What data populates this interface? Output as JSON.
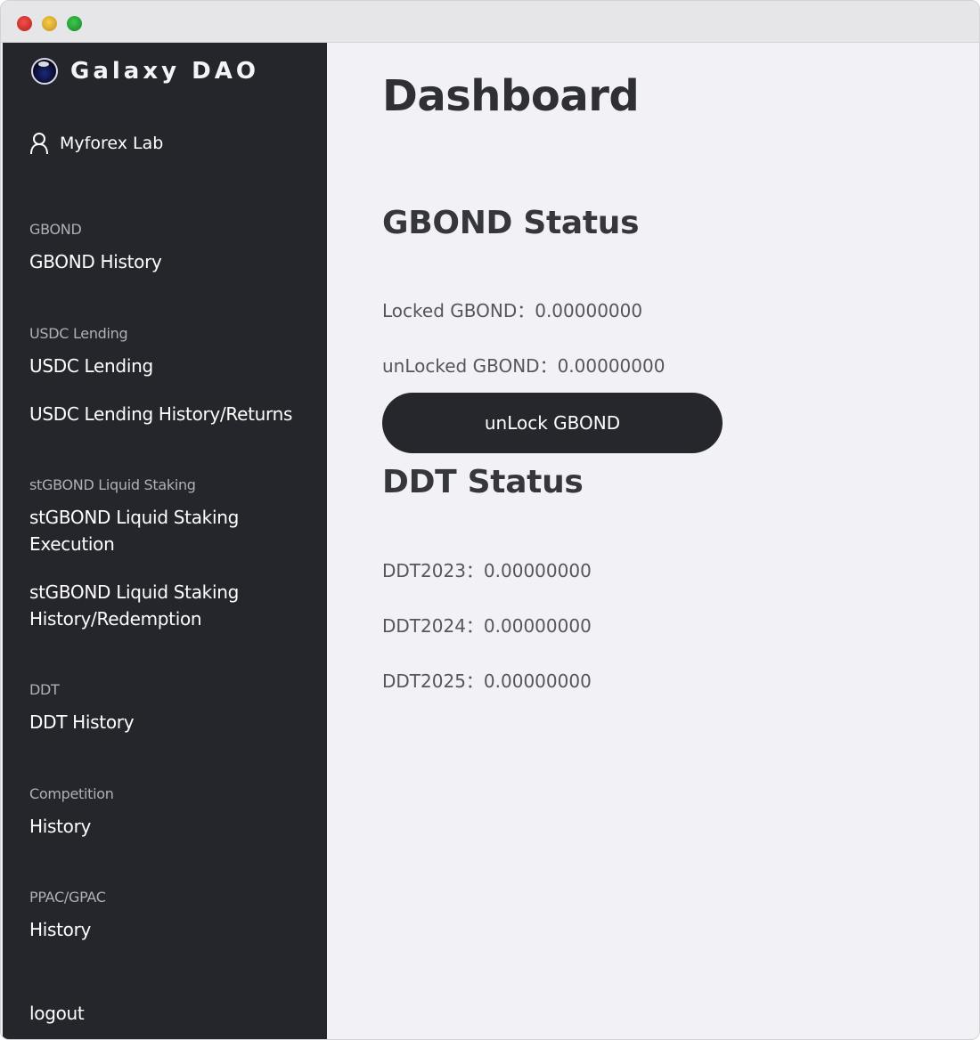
{
  "brand": {
    "name": "Galaxy DAO"
  },
  "user": {
    "name": "Myforex Lab"
  },
  "sidebar": {
    "sections": [
      {
        "header": "GBOND",
        "items": [
          "GBOND History"
        ]
      },
      {
        "header": "USDC Lending",
        "items": [
          "USDC Lending",
          "USDC Lending History/Returns"
        ]
      },
      {
        "header": "stGBOND Liquid Staking",
        "items": [
          "stGBOND Liquid Staking Execution",
          "stGBOND Liquid Staking History/Redemption"
        ]
      },
      {
        "header": "DDT",
        "items": [
          "DDT History"
        ]
      },
      {
        "header": "Competition",
        "items": [
          "History"
        ]
      },
      {
        "header": "PPAC/GPAC",
        "items": [
          "History"
        ]
      }
    ],
    "logout": "logout"
  },
  "main": {
    "title": "Dashboard",
    "gbond": {
      "title": "GBOND Status",
      "locked": "Locked GBOND：0.00000000",
      "unlocked": "unLocked GBOND：0.00000000",
      "unlock_button": "unLock GBOND"
    },
    "ddt": {
      "title": "DDT Status",
      "rows": [
        "DDT2023：0.00000000",
        "DDT2024：0.00000000",
        "DDT2025：0.00000000"
      ]
    }
  }
}
